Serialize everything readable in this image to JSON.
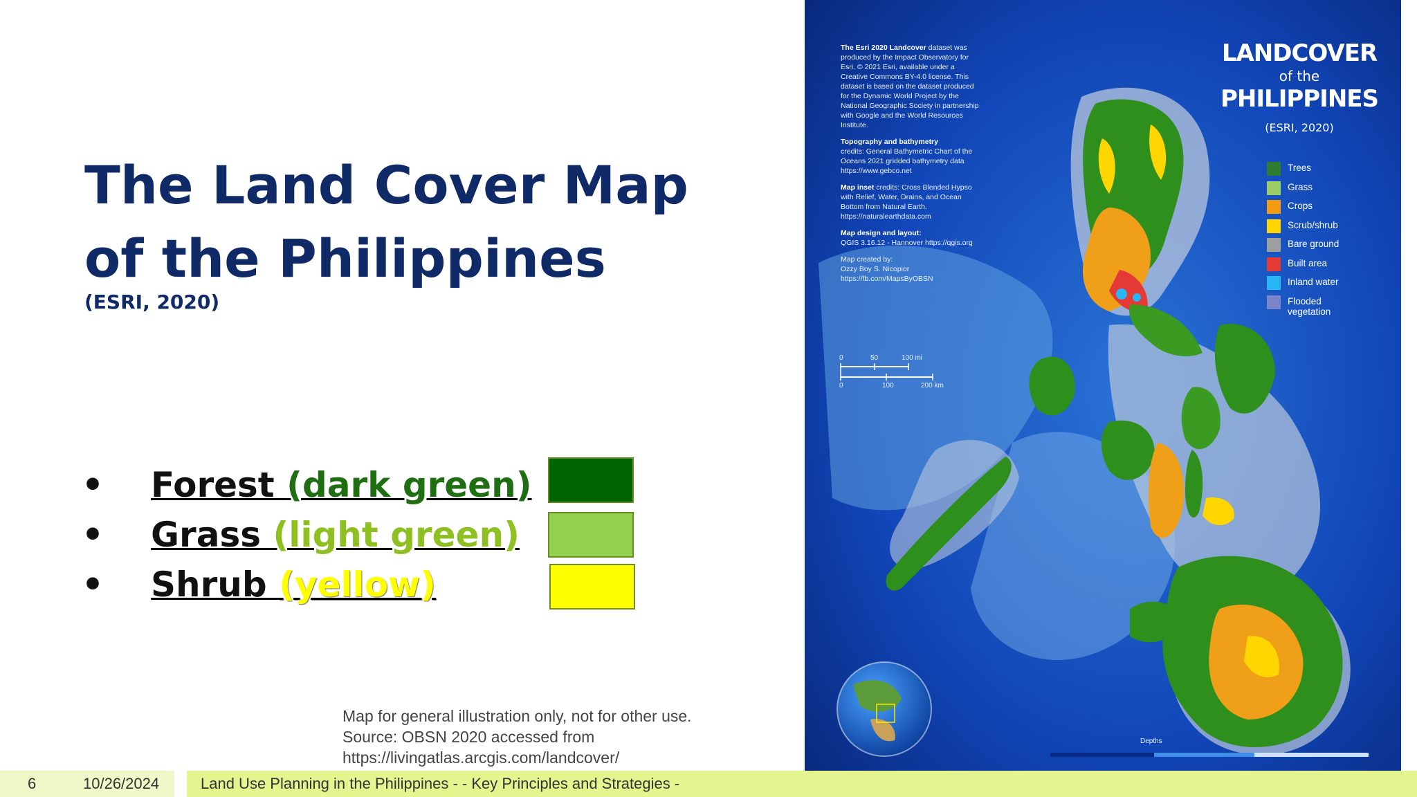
{
  "slide": {
    "title": "The Land Cover Map of the Philippines",
    "subtitle": "(ESRI, 2020)",
    "bullets": [
      {
        "symbol": "•",
        "name": "Forest ",
        "color_desc": "(dark green)",
        "text_color": "#1f6f12",
        "swatch_color": "#006400"
      },
      {
        "symbol": "•",
        "name": "Grass ",
        "color_desc": "(light green)",
        "text_color": "#8fc021",
        "swatch_color": "#92d050"
      },
      {
        "symbol": "•",
        "name": "Shrub ",
        "color_desc": "(yellow)",
        "text_color": "#ffff00",
        "swatch_color": "#ffff00"
      }
    ],
    "note_lines": [
      "Map for general illustration only, not for other use.",
      "Source: OBSN 2020 accessed from",
      "https://livingatlas.arcgis.com/landcover/"
    ]
  },
  "footer": {
    "page_number": "6",
    "date": "10/26/2024",
    "text": "Land Use Planning in the Philippines - - Key Principles and Strategies -"
  },
  "map": {
    "title_line1": "LANDCOVER",
    "title_line2": "of the",
    "title_line3": "PHILIPPINES",
    "source": "(ESRI, 2020)",
    "legend": [
      {
        "label": "Trees",
        "color": "#2e7d32"
      },
      {
        "label": "Grass",
        "color": "#9ccc65"
      },
      {
        "label": "Crops",
        "color": "#f39c12"
      },
      {
        "label": "Scrub/shrub",
        "color": "#ffd600"
      },
      {
        "label": "Bare ground",
        "color": "#9e9e9e"
      },
      {
        "label": "Built area",
        "color": "#e53935"
      },
      {
        "label": "Inland water",
        "color": "#29b6f6"
      },
      {
        "label": "Flooded vegetation",
        "color": "#7986cb"
      }
    ],
    "credits": {
      "esri_title": "The Esri 2020 Landcover",
      "esri_text": "dataset was produced by the Impact Observatory for Esri. © 2021 Esri, available under a Creative Commons BY-4.0 license. This dataset is based on the dataset produced for the Dynamic World Project by the National Geographic Society in partnership with Google and the World Resources Institute.",
      "topo_title": "Topography and bathymetry",
      "topo_text": "credits: General Bathymetric Chart of the Oceans 2021 gridded bathymetry data https://www.gebco.net",
      "inset_title": "Map inset",
      "inset_text": "credits: Cross Blended Hypso with Relief, Water, Drains, and Ocean Bottom from Natural Earth. https://naturalearthdata.com",
      "design_title": "Map design and layout:",
      "design_text": "QGIS 3.16.12 - Hannover https://qgis.org",
      "created_title": "Map created by:",
      "created_text": "Ozzy Boy S. Nicopior https://fb.com/MapsByOBSN"
    },
    "scale": {
      "mi_labels": [
        "0",
        "50",
        "100 mi"
      ],
      "km_labels": [
        "0",
        "100",
        "200 km"
      ]
    },
    "depth_label": "Depths"
  }
}
